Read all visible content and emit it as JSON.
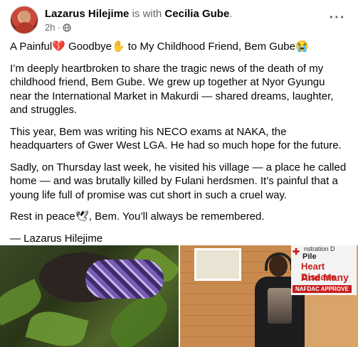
{
  "header": {
    "author": "Lazarus Hilejime",
    "with_text": "is with",
    "tagged": "Cecilia Gube",
    "tagged_suffix": ".",
    "time": "2h",
    "dot": "·",
    "more_glyph": "···"
  },
  "post": {
    "headline_prefix": "A Painful",
    "headline_mid1": " Goodbye",
    "headline_mid2": " to My Childhood Friend, Bem Gube",
    "p1": "I’m deeply heartbroken to share the tragic news of the death of my childhood friend, Bem Gube. We grew up together at Nyor Gyungu near the International Market in Makurdi — shared dreams, laughter, and struggles.",
    "p2": "This year, Bem was writing his NECO exams at NAKA, the headquarters of Gwer West LGA. He had so much hope for the future.",
    "p3": "Sadly, on Thursday last week, he visited his village — a place he called home — and was brutally killed by Fulani herdsmen. It’s painful that a young life full of promise was cut short in such a cruel way.",
    "p4_prefix": "Rest in peace",
    "p4_suffix": ", Bem. You’ll always be remembered.",
    "signature": "— Lazarus Hilejime"
  },
  "emoji": {
    "broken_heart": "💔",
    "hand": "✋",
    "crying": "😭",
    "dove": "🕊"
  },
  "photos": {
    "sign_line1": "nstration D",
    "sign_line2": "Pile",
    "sign_line3": "Heart Disease",
    "sign_line4": "And Many",
    "sign_line5": "NAFDAC APPROVE"
  },
  "colors": {
    "text": "#050505",
    "muted": "#65676b",
    "sign_red": "#c81e1e"
  }
}
